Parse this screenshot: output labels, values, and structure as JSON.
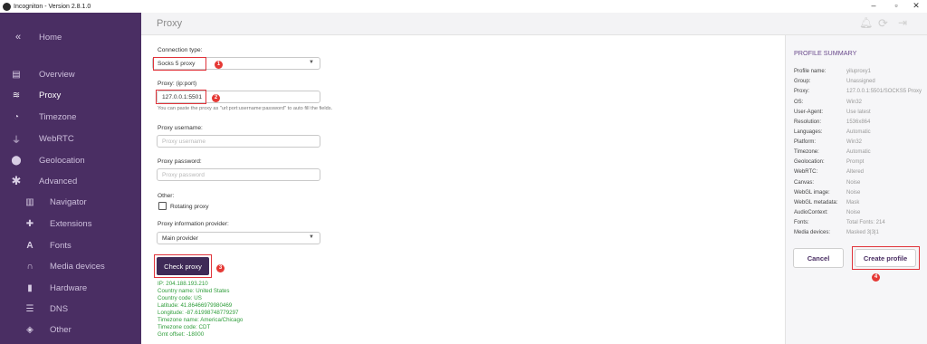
{
  "window": {
    "title": "Incogniton - Version 2.8.1.0",
    "minimize_glyph": "–",
    "maximize_glyph": "▫",
    "close_glyph": "✕"
  },
  "sidebar": {
    "collapse_glyph": "«",
    "items": [
      {
        "label": "Home",
        "icon": "collapse-icon"
      },
      {
        "label": "Overview",
        "icon": "overview-icon"
      },
      {
        "label": "Proxy",
        "icon": "wifi-icon",
        "active": true
      },
      {
        "label": "Timezone",
        "icon": "clock-icon"
      },
      {
        "label": "WebRTC",
        "icon": "plug-icon"
      },
      {
        "label": "Geolocation",
        "icon": "location-pin-icon"
      },
      {
        "label": "Advanced",
        "icon": "asterisk-icon"
      },
      {
        "label": "Navigator",
        "icon": "map-icon"
      },
      {
        "label": "Extensions",
        "icon": "puzzle-icon"
      },
      {
        "label": "Fonts",
        "icon": "font-icon"
      },
      {
        "label": "Media devices",
        "icon": "headphones-icon"
      },
      {
        "label": "Hardware",
        "icon": "memory-icon"
      },
      {
        "label": "DNS",
        "icon": "dns-icon"
      },
      {
        "label": "Other",
        "icon": "box-icon"
      }
    ]
  },
  "header": {
    "title": "Proxy"
  },
  "form": {
    "connection_type_label": "Connection type:",
    "connection_type_value": "Socks 5 proxy",
    "proxy_label": "Proxy: (ip:port)",
    "proxy_value": "127.0.0.1:5501",
    "proxy_hint": "You can paste the proxy as \"url:port:username:password\" to auto fill the fields.",
    "username_label": "Proxy username:",
    "username_placeholder": "Proxy username",
    "password_label": "Proxy password:",
    "password_placeholder": "Proxy password",
    "other_label": "Other:",
    "rotating_label": "Rotating proxy",
    "provider_label": "Proxy information provider:",
    "provider_value": "Main provider",
    "check_button": "Check proxy",
    "badges": [
      "1",
      "2",
      "3",
      "4"
    ]
  },
  "result": {
    "lines": [
      "IP: 204.188.193.210",
      "Country name: United States",
      "Country code: US",
      "Latitude: 41.86466979980469",
      "Longitude: -87.61998748779297",
      "Timezone name: America/Chicago",
      "Timezone code: CDT",
      "Gmt offset: -18000"
    ]
  },
  "summary": {
    "title": "PROFILE SUMMARY",
    "rows": [
      {
        "key": "Profile name:",
        "value": "yiluproxy1"
      },
      {
        "key": "Group:",
        "value": "Unassigned"
      },
      {
        "key": "Proxy:",
        "value": "127.0.0.1:5501/SOCKS5 Proxy"
      },
      {
        "key": "OS:",
        "value": "Win32"
      },
      {
        "key": "User-Agent:",
        "value": "Use latest"
      },
      {
        "key": "Resolution:",
        "value": "1536x864"
      },
      {
        "key": "Languages:",
        "value": "Automatic"
      },
      {
        "key": "Platform:",
        "value": "Win32"
      },
      {
        "key": "Timezone:",
        "value": "Automatic"
      },
      {
        "key": "Geolocation:",
        "value": "Prompt"
      },
      {
        "key": "WebRTC:",
        "value": "Altered"
      },
      {
        "key": "Canvas:",
        "value": "Noise"
      },
      {
        "key": "WebGL image:",
        "value": "Noise"
      },
      {
        "key": "WebGL metadata:",
        "value": "Mask"
      },
      {
        "key": "AudioContext:",
        "value": "Noise"
      },
      {
        "key": "Fonts:",
        "value": "Total Fonts: 214"
      },
      {
        "key": "Media devices:",
        "value": "Masked 3|3|1"
      }
    ],
    "cancel_button": "Cancel",
    "create_button": "Create profile"
  },
  "colors": {
    "sidebar": "#4a2e63",
    "accent": "#3f2a57",
    "annotation_red": "#e53935",
    "result_green": "#2e9d3a"
  }
}
